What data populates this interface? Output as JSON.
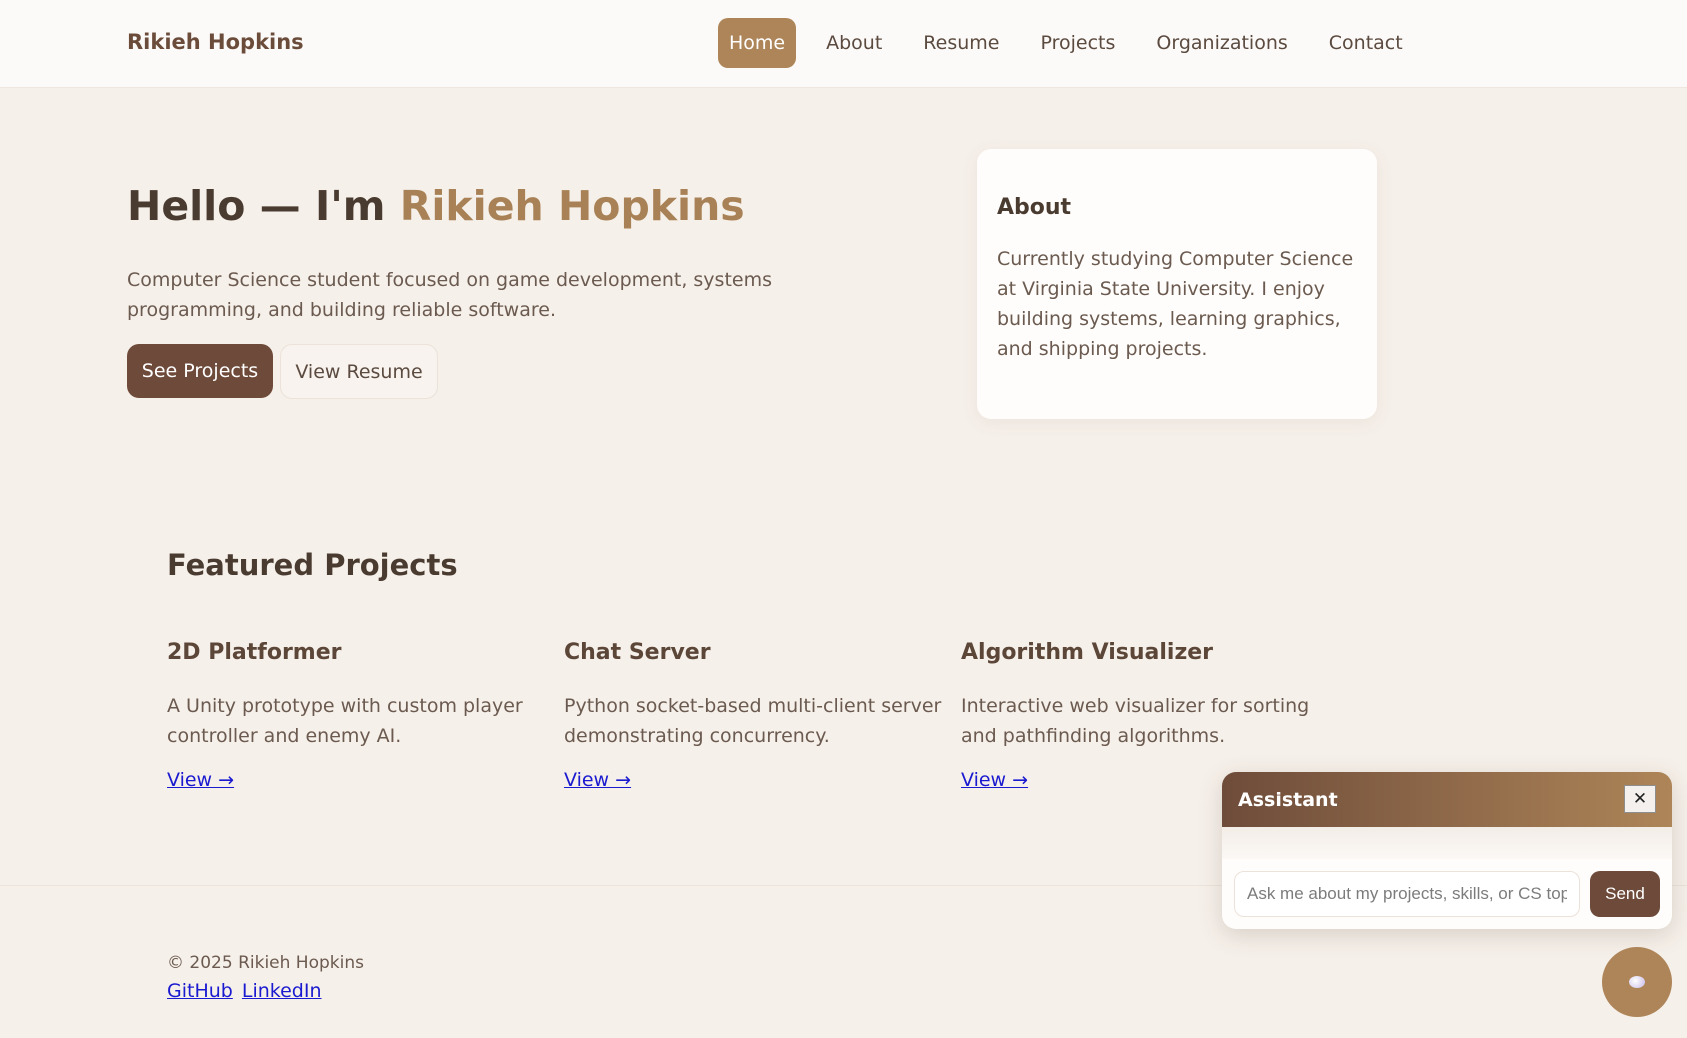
{
  "brand": "Rikieh Hopkins",
  "nav": {
    "items": [
      "Home",
      "About",
      "Resume",
      "Projects",
      "Organizations",
      "Contact"
    ],
    "active": "Home"
  },
  "hero": {
    "title_prefix": "Hello — I'm ",
    "title_name": "Rikieh Hopkins",
    "subtitle": "Computer Science student focused on game development, systems programming, and building reliable software.",
    "primary_button": "See Projects",
    "secondary_button": "View Resume"
  },
  "about_card": {
    "title": "About",
    "text": "Currently studying Computer Science at Virginia State University. I enjoy building systems, learning graphics, and shipping projects."
  },
  "featured": {
    "title": "Featured Projects",
    "projects": [
      {
        "title": "2D Platformer",
        "description": "A Unity prototype with custom player controller and enemy AI.",
        "link": "View →"
      },
      {
        "title": "Chat Server",
        "description": "Python socket-based multi-client server demonstrating concurrency.",
        "link": "View →"
      },
      {
        "title": "Algorithm Visualizer",
        "description": "Interactive web visualizer for sorting and pathfinding algorithms.",
        "link": "View →"
      }
    ]
  },
  "footer": {
    "copyright": "© 2025 Rikieh Hopkins",
    "links": [
      "GitHub",
      "LinkedIn"
    ]
  },
  "assistant": {
    "title": "Assistant",
    "close_icon": "close-icon",
    "input_placeholder": "Ask me about my projects, skills, or CS topics",
    "send_label": "Send"
  },
  "colors": {
    "background": "#f6f0ea",
    "accent": "#ae8558",
    "primary_dark": "#6d4a39",
    "link": "#1a1ad0"
  }
}
